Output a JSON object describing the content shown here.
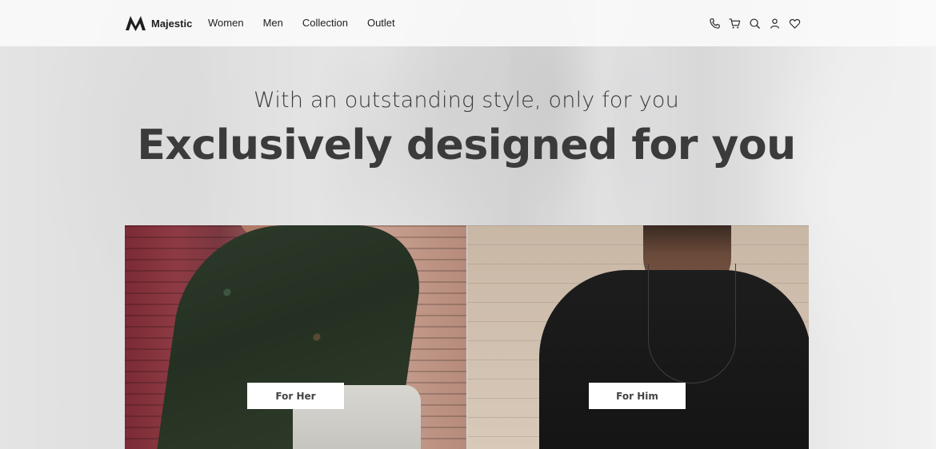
{
  "brand": {
    "name": "Majestic",
    "logo_icon": "majestic-m-logo-icon"
  },
  "nav": {
    "items": [
      {
        "label": "Women"
      },
      {
        "label": "Men"
      },
      {
        "label": "Collection"
      },
      {
        "label": "Outlet"
      }
    ]
  },
  "header_icons": [
    "phone-icon",
    "cart-icon",
    "search-icon",
    "user-icon",
    "heart-icon"
  ],
  "hero": {
    "subtitle": "With an outstanding style, only for you",
    "title": "Exclusively designed for you"
  },
  "categories": [
    {
      "button_label": "For Her",
      "image": "woman-in-green-paisley-shirt-photo"
    },
    {
      "button_label": "For Him",
      "image": "man-in-black-tshirt-photo"
    }
  ],
  "colors": {
    "text_dark": "#3b3b3b",
    "header_bg": "#fafafa",
    "button_bg": "#ffffff"
  }
}
